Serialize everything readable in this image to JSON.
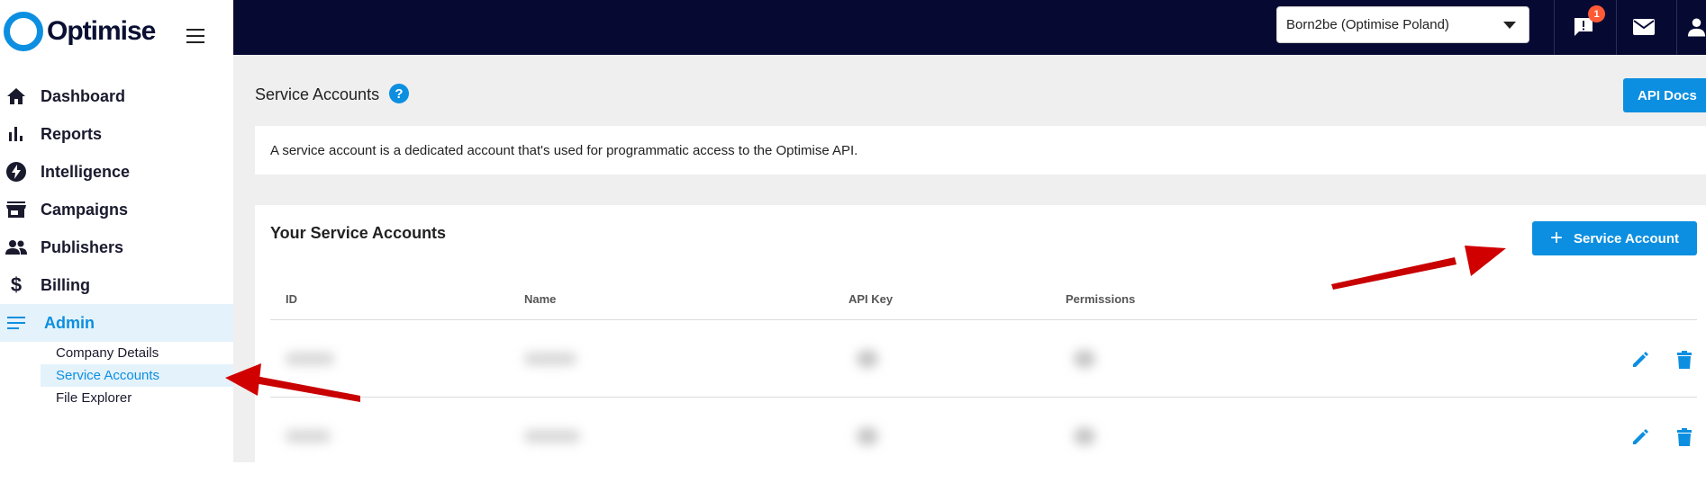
{
  "brand": {
    "name": "Optimise",
    "colors": {
      "primary": "#0c8fe0",
      "topbar": "#060a33",
      "badge": "#ff5a36",
      "annotation": "#d00000"
    }
  },
  "sidebar": {
    "items": [
      {
        "label": "Dashboard",
        "icon": "home-icon"
      },
      {
        "label": "Reports",
        "icon": "bar-chart-icon"
      },
      {
        "label": "Intelligence",
        "icon": "bolt-icon"
      },
      {
        "label": "Campaigns",
        "icon": "store-icon"
      },
      {
        "label": "Publishers",
        "icon": "people-icon"
      },
      {
        "label": "Billing",
        "icon": "dollar-icon"
      },
      {
        "label": "Admin",
        "icon": "list-icon",
        "active": true
      }
    ],
    "admin_subitems": [
      {
        "label": "Company Details"
      },
      {
        "label": "Service Accounts",
        "active": true
      },
      {
        "label": "File Explorer"
      }
    ]
  },
  "topbar": {
    "account_selected": "Born2be (Optimise Poland)",
    "notifications_count": "1",
    "icons": [
      "notification-icon",
      "mail-icon",
      "user-icon"
    ]
  },
  "page": {
    "title": "Service Accounts",
    "help_label": "?",
    "api_docs_label": "API Docs",
    "info_text": "A service account is a dedicated account that's used for programmatic access to the Optimise API."
  },
  "accounts": {
    "title": "Your Service Accounts",
    "add_button_label": "Service Account",
    "add_button_symbol": "+",
    "columns": [
      "ID",
      "Name",
      "API Key",
      "Permissions"
    ]
  }
}
